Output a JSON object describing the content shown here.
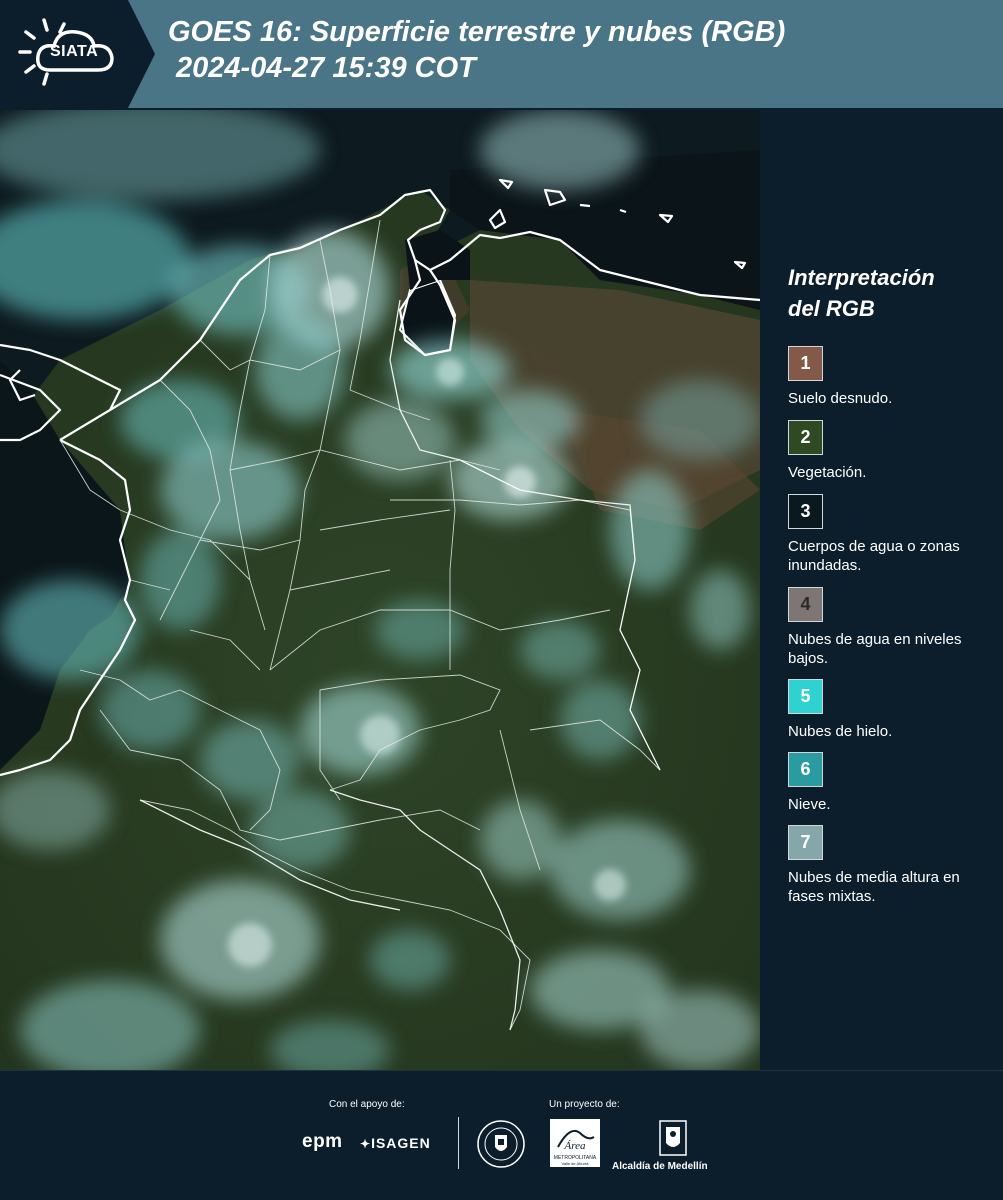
{
  "header": {
    "logo_text": "SIATA",
    "title_line1": "GOES 16: Superficie terrestre y nubes (RGB)",
    "title_line2": "2024-04-27 15:39 COT",
    "background_color": "#4a7587"
  },
  "legend": {
    "title_line1": "Interpretación",
    "title_line2": "del RGB",
    "items": [
      {
        "number": "1",
        "label": "Suelo desnudo.",
        "color": "#84594a"
      },
      {
        "number": "2",
        "label": "Vegetación.",
        "color": "#2f4a22"
      },
      {
        "number": "3",
        "label": "Cuerpos de agua o zonas inundadas.",
        "color": "#0a1820"
      },
      {
        "number": "4",
        "label": "Nubes de agua en niveles bajos.",
        "color": "#7e7672"
      },
      {
        "number": "5",
        "label": "Nubes de hielo.",
        "color": "#2fd2d0"
      },
      {
        "number": "6",
        "label": "Nieve.",
        "color": "#2a9ba0"
      },
      {
        "number": "7",
        "label": "Nubes de media altura en fases mixtas.",
        "color": "#86a7aa"
      }
    ]
  },
  "footer": {
    "support_label": "Con el apoyo de:",
    "project_label": "Un proyecto de:",
    "epm": "epm",
    "isagen": "ISAGEN",
    "alcaldia": "Alcaldía de Medellín"
  }
}
